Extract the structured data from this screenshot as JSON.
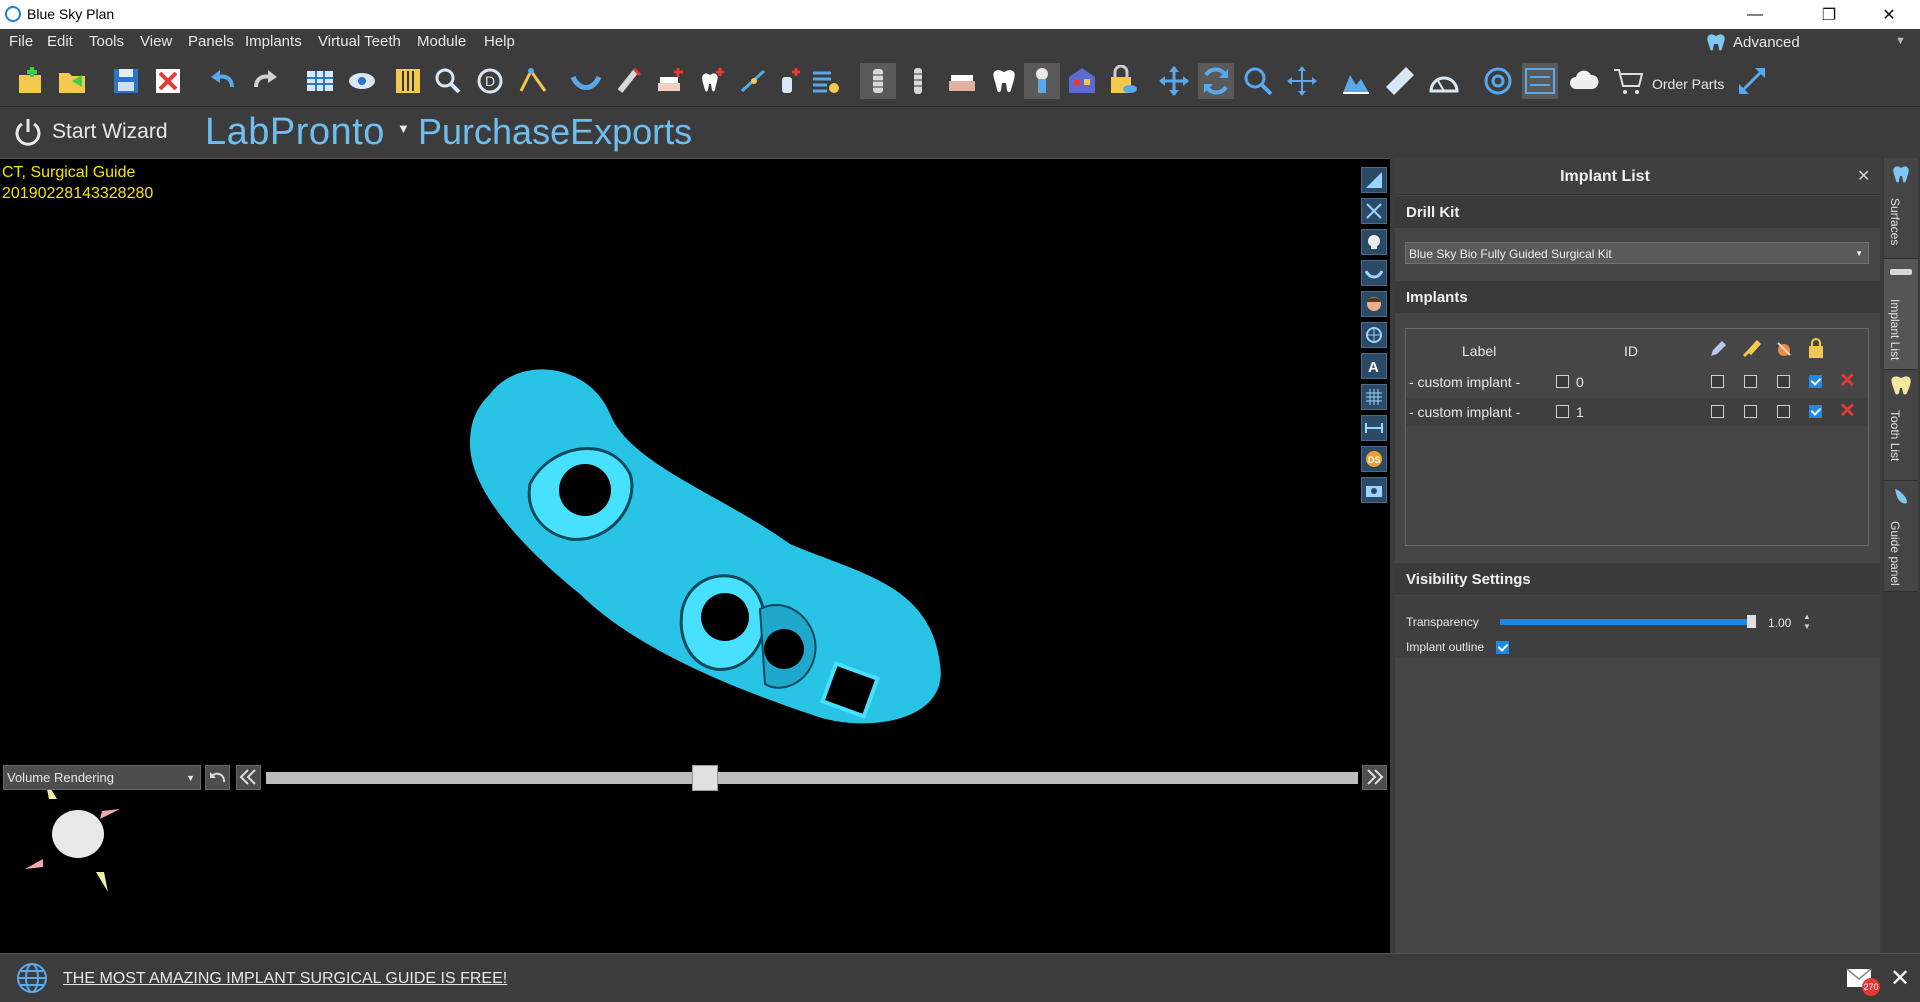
{
  "window": {
    "title": "Blue Sky Plan"
  },
  "menu": [
    "File",
    "Edit",
    "Tools",
    "View",
    "Panels",
    "Implants",
    "Virtual Teeth",
    "Module",
    "Help"
  ],
  "mode": {
    "label": "Advanced"
  },
  "toolbar": {
    "order_parts_label": "Order Parts"
  },
  "toolbar2": {
    "start_wizard_label": "Start Wizard",
    "labpronto_label": "LabPronto",
    "purchase_exports_label": "PurchaseExports"
  },
  "viewport": {
    "info_line1": "CT, Surgical Guide",
    "info_line2": "20190228143328280",
    "render_mode": "Volume Rendering",
    "slice_position": 0.4
  },
  "panel": {
    "title": "Implant List",
    "drill_kit_heading": "Drill Kit",
    "drill_kit_value": "Blue Sky Bio Fully Guided Surgical Kit",
    "implants_heading": "Implants",
    "columns": {
      "label": "Label",
      "id": "ID"
    },
    "rows": [
      {
        "label": "- custom implant -",
        "id": "0",
        "locked": true
      },
      {
        "label": "- custom implant -",
        "id": "1",
        "locked": true
      }
    ],
    "visibility_heading": "Visibility Settings",
    "transparency_label": "Transparency",
    "transparency_value": "1.00",
    "implant_outline_label": "Implant outline",
    "implant_outline_checked": true
  },
  "side_tabs": [
    "Surfaces",
    "Implant List",
    "Tooth List",
    "Guide panel"
  ],
  "status": {
    "link_text": "THE MOST AMAZING IMPLANT SURGICAL GUIDE IS FREE!",
    "mail_count": "270"
  },
  "colors": {
    "accent": "#1e88e5",
    "brand_text": "#6fbef0",
    "viewport_text": "#f4e400",
    "guide_model": "#29c3e6"
  }
}
